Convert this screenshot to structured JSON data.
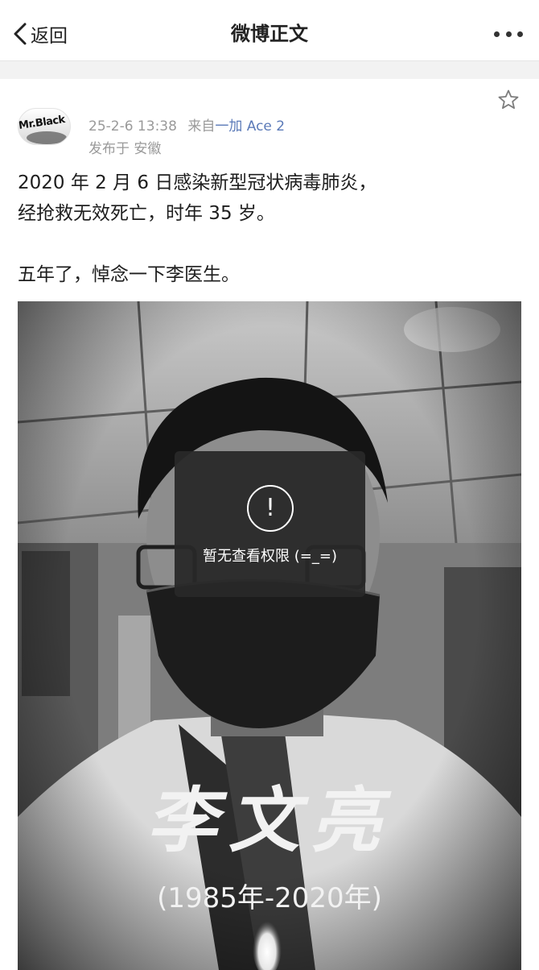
{
  "nav": {
    "back_label": "返回",
    "title": "微博正文"
  },
  "post": {
    "avatar_text": "Mr.Black",
    "date": "25-2-6 13:38",
    "source_prefix": "来自",
    "source_device": "一加 Ace 2",
    "location": "发布于 安徽",
    "text_line1": "2020 年 2 月 6 日感染新型冠状病毒肺炎，",
    "text_line2": "经抢救无效死亡，时年 35 岁。",
    "text_line3": "五年了，悼念一下李医生。",
    "image": {
      "caption_name": "李文亮",
      "caption_years": "(1985年-2020年)"
    }
  },
  "overlay": {
    "icon_glyph": "!",
    "message": "暂无查看权限 (=_=)"
  }
}
